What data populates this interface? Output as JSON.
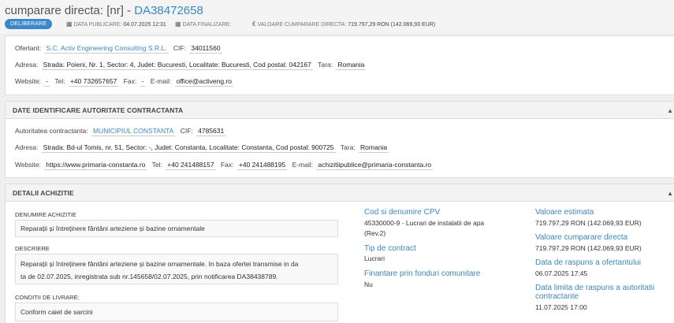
{
  "header": {
    "title_prefix": "cumparare directa: [nr] - ",
    "title_code": "DA38472658",
    "status": "DELIBERARE",
    "publish_label": "DATA PUBLICARE:",
    "publish_value": "04.07.2025 12:31",
    "finalize_label": "DATA FINALIZARE:",
    "value_label": "VALOARE CUMPARARE DIRECTA:",
    "value_value": "719.797,29 RON (142.069,93 EUR)"
  },
  "ofertant": {
    "name_label": "Ofertant:",
    "name": "S.C. Activ Engineering Consulting S.R.L.",
    "cif_label": "CIF:",
    "cif": "34011560",
    "address_label": "Adresa:",
    "address": "Strada: Poieni, Nr. 1, Sector: 4, Judet: Bucuresti, Localitate: Bucuresti, Cod postal: 042167",
    "country_label": "Tara:",
    "country": "Romania",
    "website_label": "Website:",
    "website": "-",
    "tel_label": "Tel:",
    "tel": "+40 732657657",
    "fax_label": "Fax:",
    "fax": "-",
    "email_label": "E-mail:",
    "email": "office@activeng.ro"
  },
  "autoritate": {
    "section_title": "DATE IDENTIFICARE AUTORITATE CONTRACTANTA",
    "name_label": "Autoritatea contractanta:",
    "name": "MUNICIPIUL CONSTANTA",
    "cif_label": "CIF:",
    "cif": "4785631",
    "address_label": "Adresa:",
    "address": "Strada: Bd-ul Tomis, nr. 51, Sector: -, Judet: Constanta, Localitate: Constanta, Cod postal: 900725",
    "country_label": "Tara:",
    "country": "Romania",
    "website_label": "Website:",
    "website": "https://www.primaria-constanta.ro",
    "tel_label": "Tel:",
    "tel": "+40 241488157",
    "fax_label": "Fax:",
    "fax": "+40 241488195",
    "email_label": "E-mail:",
    "email": "achizitiipublice@primaria-constanta.ro"
  },
  "detalii": {
    "section_title": "DETALII ACHIZITIE",
    "denumire_label": "DENUMIRE ACHIZITIE",
    "denumire": "Reparații și întreținere fântâni arteziene și bazine ornamentale",
    "descriere_label": "DESCRIERE",
    "descriere_line1": "Reparații și întreținere fântâni arteziene și bazine ornamentale. In baza ofertei transmise in da",
    "descriere_line2": "ta de 02.07.2025, inregistrata sub nr.145658/02.07.2025, prin notificarea DA38438789.",
    "conditii_label": "CONDITII DE LIVRARE:",
    "conditii": "Conform caiet de sarcini",
    "cpv_label": "Cod si denumire CPV",
    "cpv_line1": "45330000-9 - Lucrari de instalatii de apa",
    "cpv_line2": "(Rev.2)",
    "tip_label": "Tip de contract",
    "tip": "Lucrari",
    "finantare_label": "Finantare prin fonduri comunitare",
    "finantare": "Nu",
    "val_estimata_label": "Valoare estimata",
    "val_estimata": "719.797,29 RON (142.069,93 EUR)",
    "val_cumparare_label": "Valoare cumparare directa",
    "val_cumparare": "719.797,29 RON (142.069,93 EUR)",
    "data_raspuns_label": "Data de raspuns a ofertantului",
    "data_raspuns": "06.07.2025 17:45",
    "data_limita_label_1": "Data limita de raspuns a autoritatii",
    "data_limita_label_2": "contractante",
    "data_limita": "11.07.2025 17:00"
  }
}
